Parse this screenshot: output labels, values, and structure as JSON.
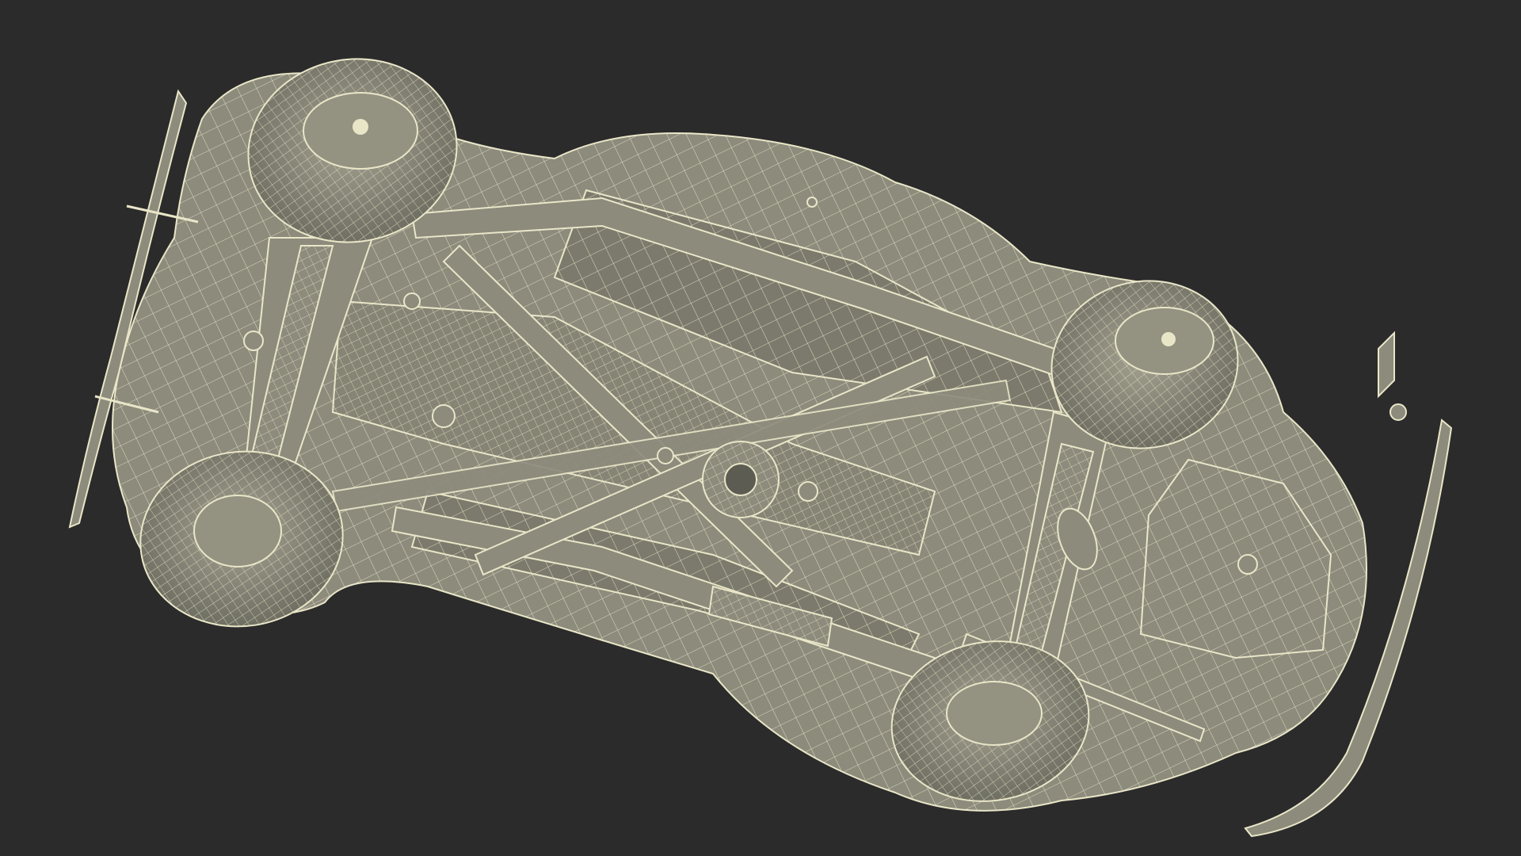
{
  "scene": {
    "background_color": "#2b2b2b",
    "surface_color": "#8c8b7c",
    "surface_shadow_color": "#6f6e62",
    "wire_color": "#e9e6c8",
    "subject": "car-underside-wireframe-icon"
  }
}
